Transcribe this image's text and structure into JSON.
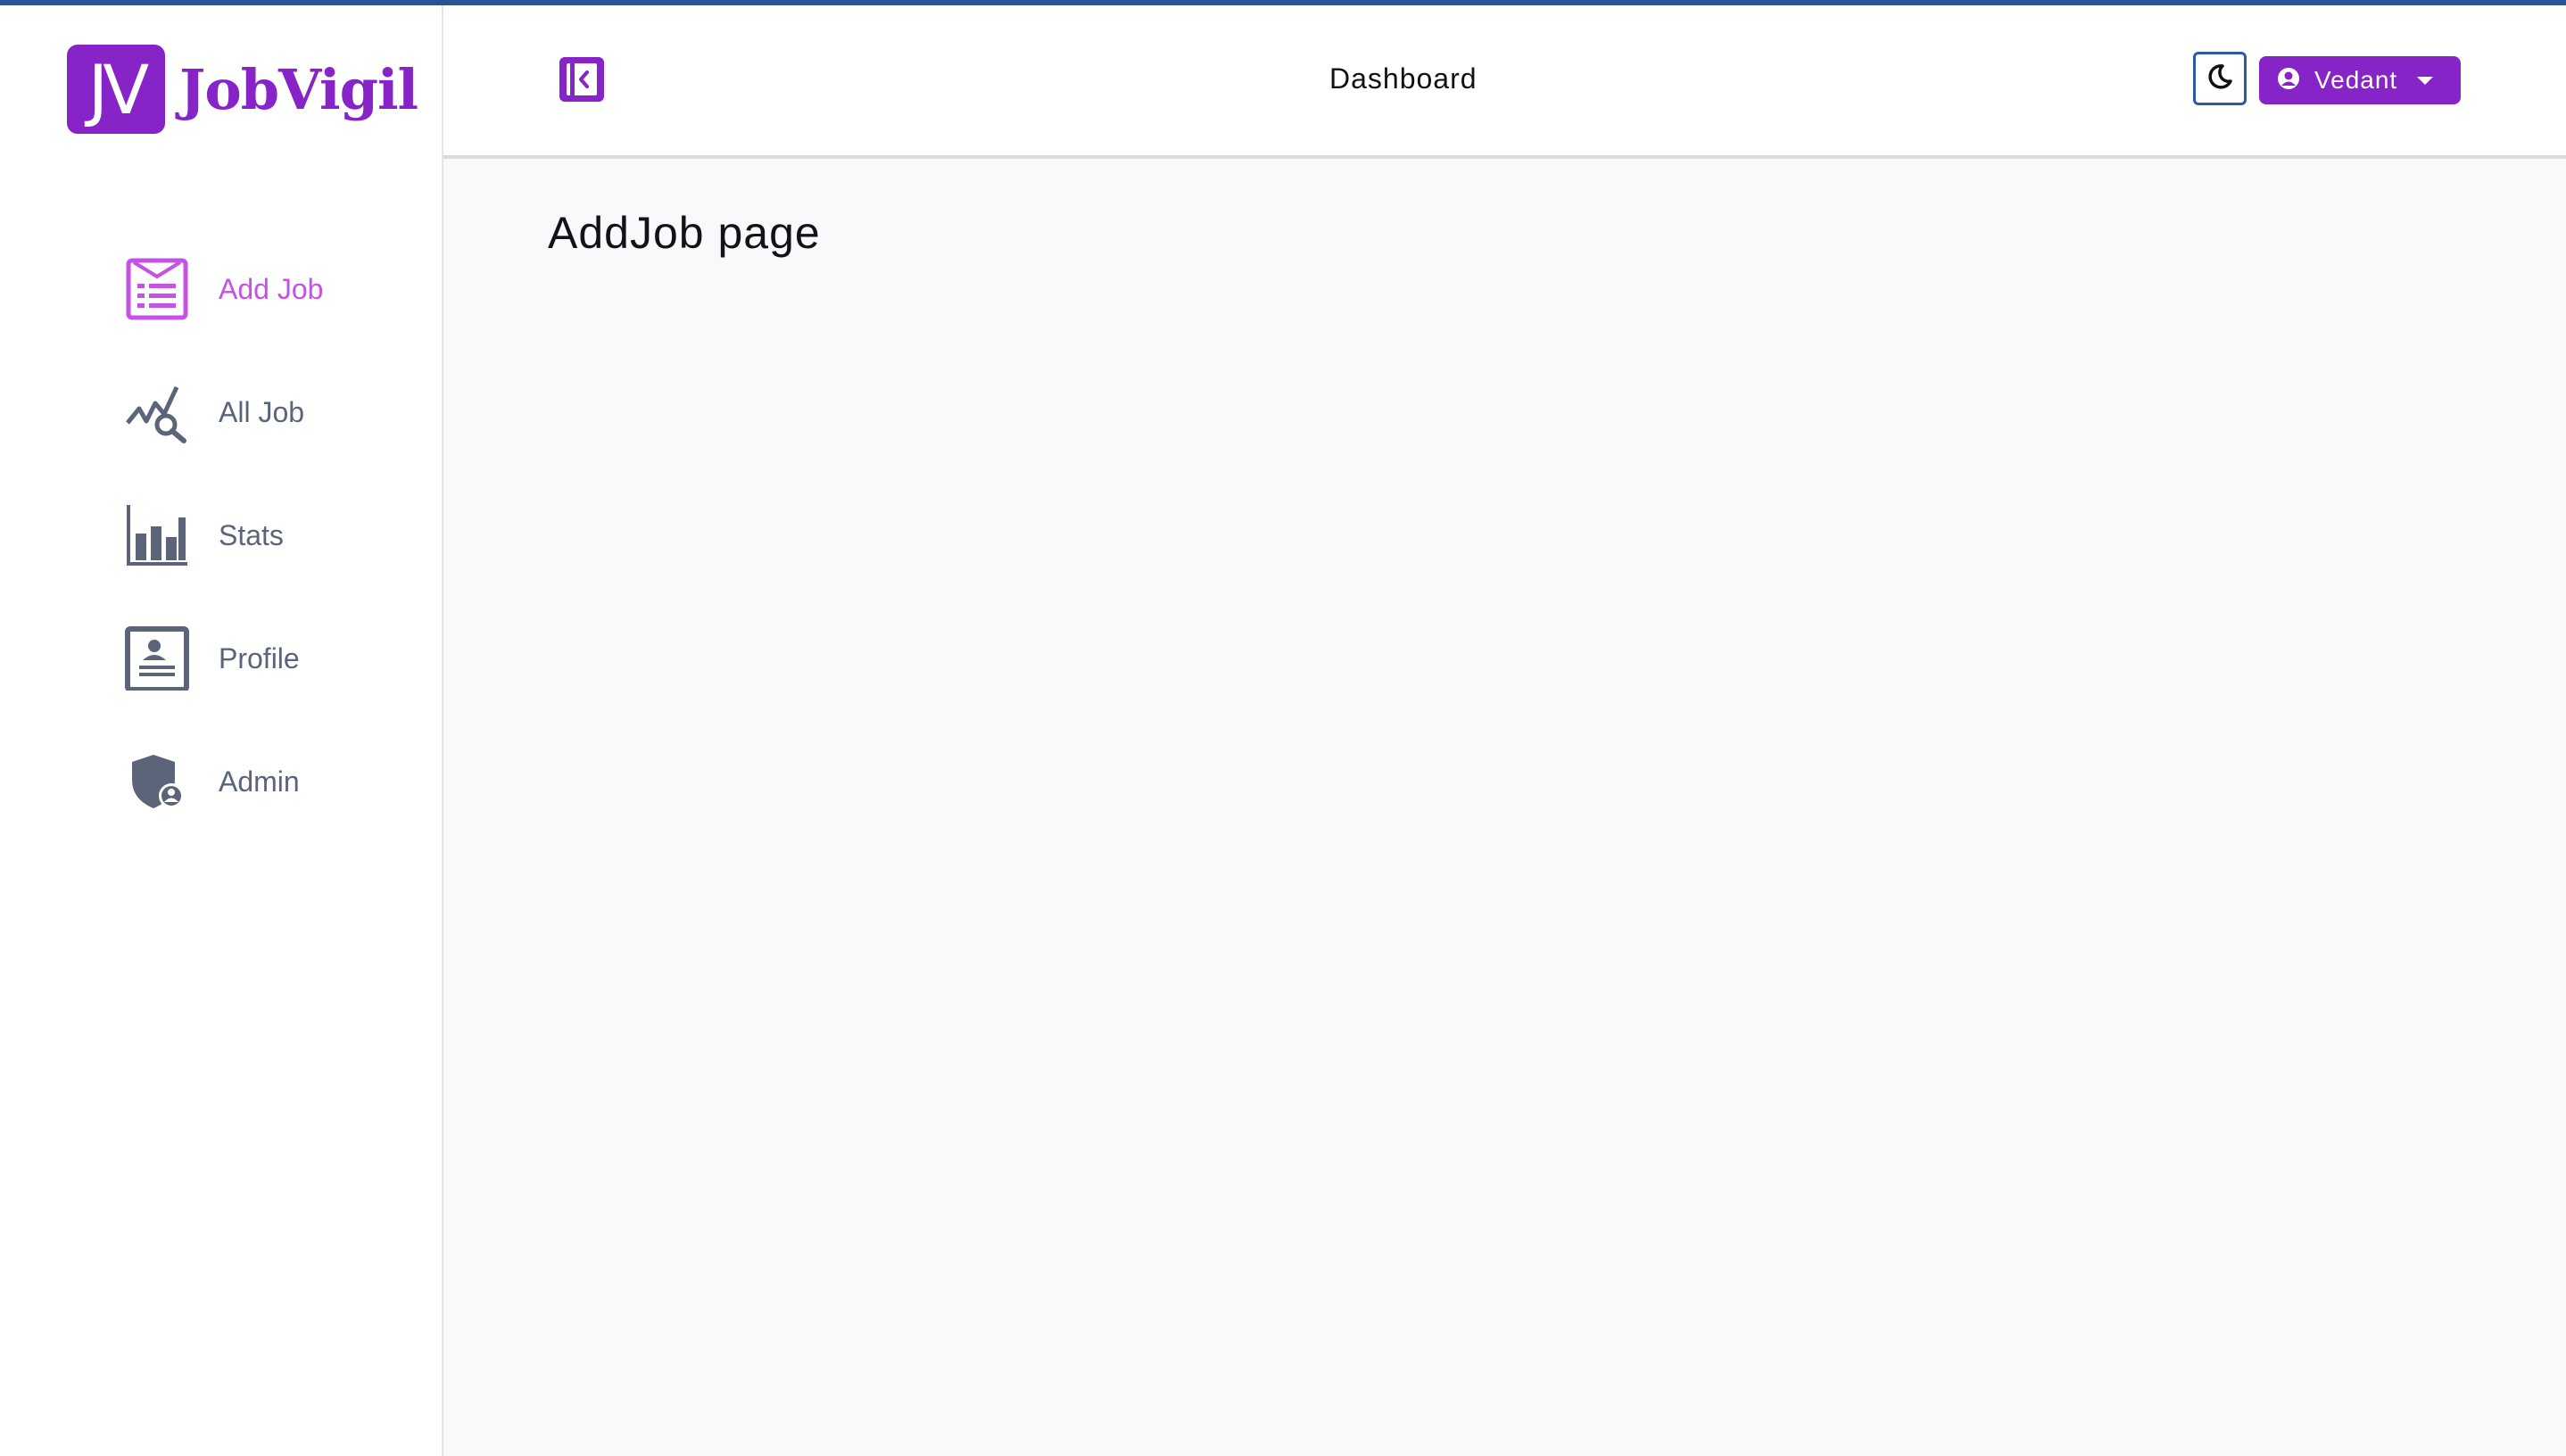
{
  "brand": {
    "logo_mark": "JV",
    "name": "JobVigil",
    "color": "#8624c7"
  },
  "sidebar": {
    "items": [
      {
        "label": "Add Job",
        "icon": "add-job-form-icon",
        "active": true
      },
      {
        "label": "All Job",
        "icon": "job-search-chart-icon",
        "active": false
      },
      {
        "label": "Stats",
        "icon": "bar-chart-icon",
        "active": false
      },
      {
        "label": "Profile",
        "icon": "profile-card-icon",
        "active": false
      },
      {
        "label": "Admin",
        "icon": "admin-shield-icon",
        "active": false
      }
    ],
    "active_color": "#c452e6",
    "inactive_color": "#5b6478"
  },
  "header": {
    "title": "Dashboard",
    "toggle_icon": "sidebar-toggle-icon",
    "theme_icon": "moon-icon",
    "user": {
      "name": "Vedant",
      "icon": "user-circle-icon",
      "caret_icon": "caret-down-icon"
    }
  },
  "main": {
    "heading": "AddJob page"
  }
}
